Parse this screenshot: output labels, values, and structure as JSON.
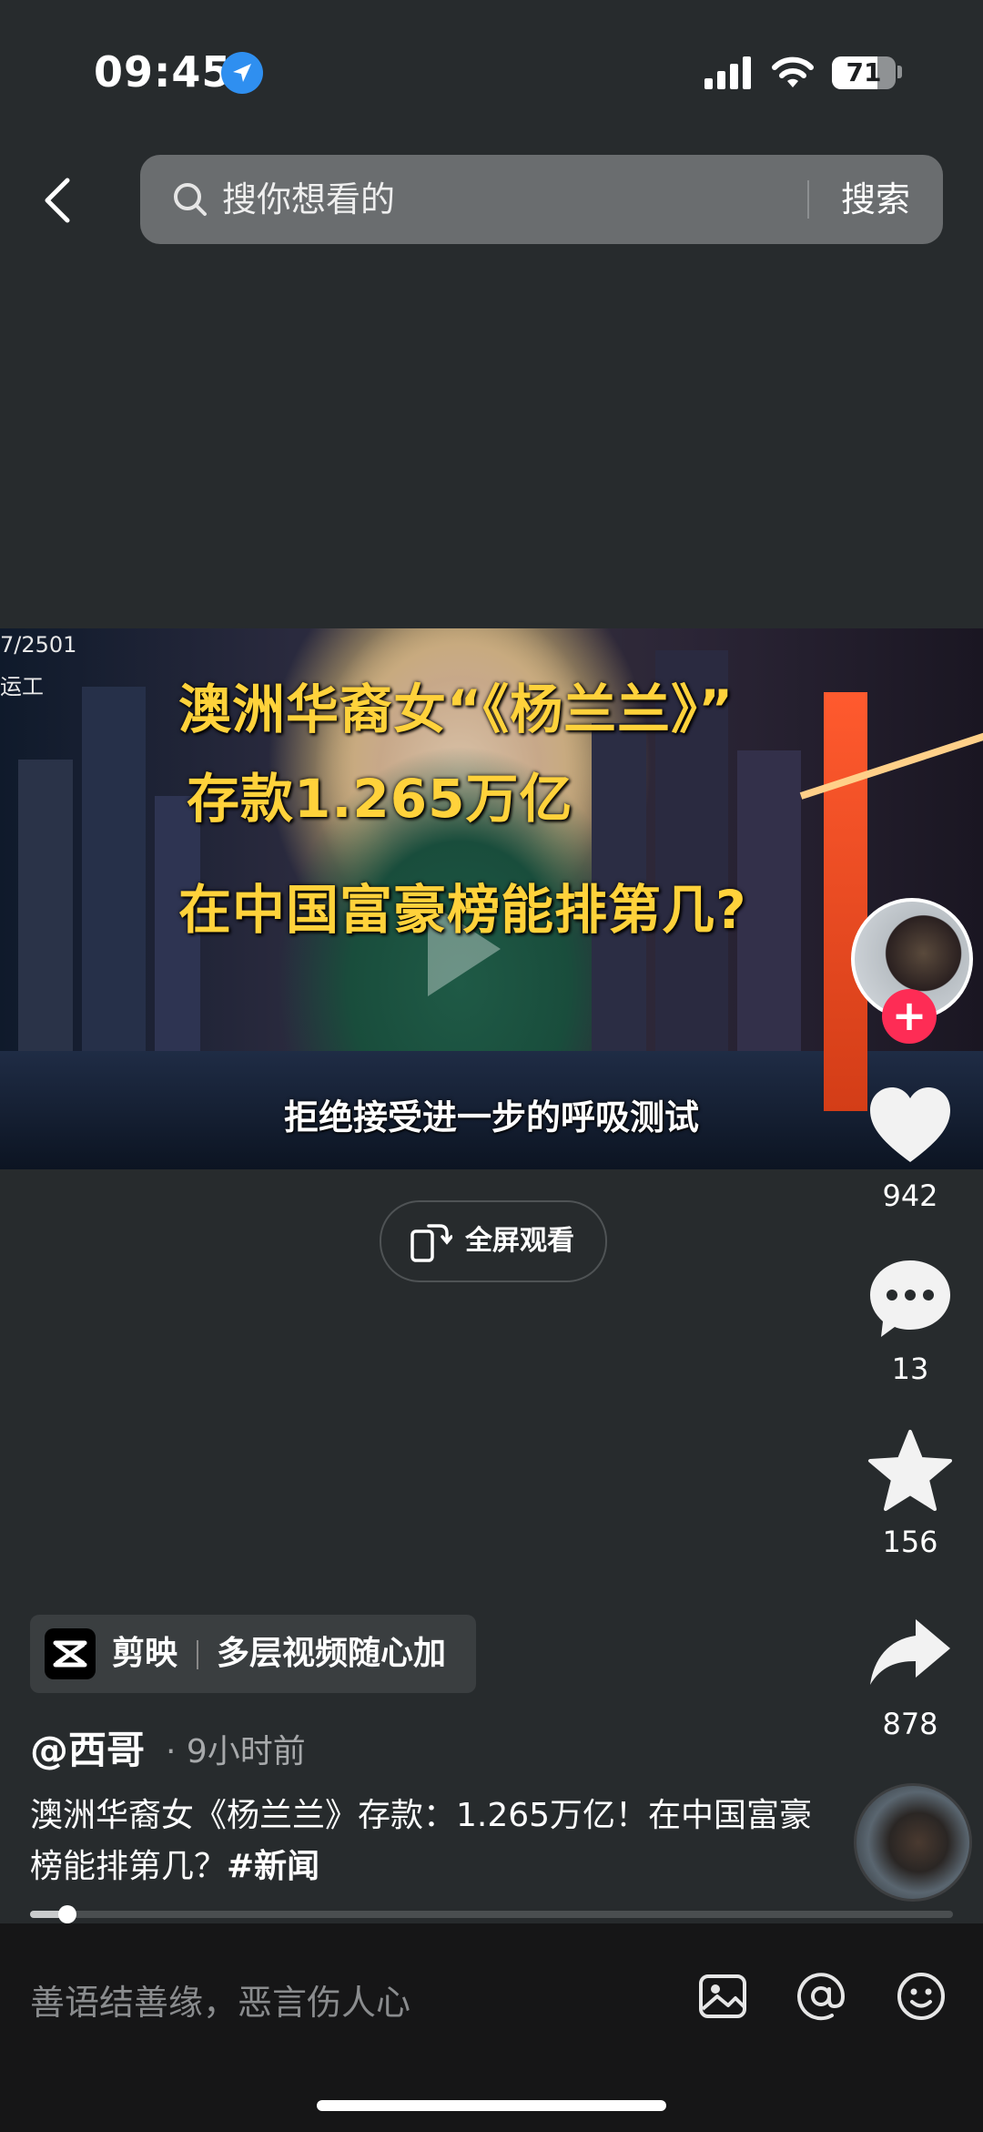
{
  "status_bar": {
    "time": "09:45",
    "battery": "71"
  },
  "search": {
    "placeholder": "搜你想看的",
    "button": "搜索"
  },
  "video": {
    "caption_line1": "澳洲华裔女“《杨兰兰》”",
    "caption_line2": "存款1.265万亿",
    "caption_line3": "在中国富豪榜能排第几?",
    "subtitle": "拒绝接受进一步的呼吸测试",
    "watermark_line1": "7/2501",
    "watermark_line2": "运工"
  },
  "fullscreen_label": "全屏观看",
  "actions": {
    "likes": "942",
    "comments": "13",
    "favorites": "156",
    "shares": "878"
  },
  "ad": {
    "app": "剪映",
    "slogan": "多层视频随心加"
  },
  "post": {
    "author": "@西哥",
    "time_ago": "· 9小时前",
    "description": "澳洲华裔女《杨兰兰》存款：1.265万亿！在中国富豪榜能排第几？",
    "hashtag": "#新闻",
    "progress": 0.04
  },
  "comment_bar": {
    "placeholder": "善语结善缘，恶言伤人心"
  },
  "colors": {
    "background": "#272b2d",
    "caption": "#ffd23b",
    "follow": "#fe2c55"
  }
}
